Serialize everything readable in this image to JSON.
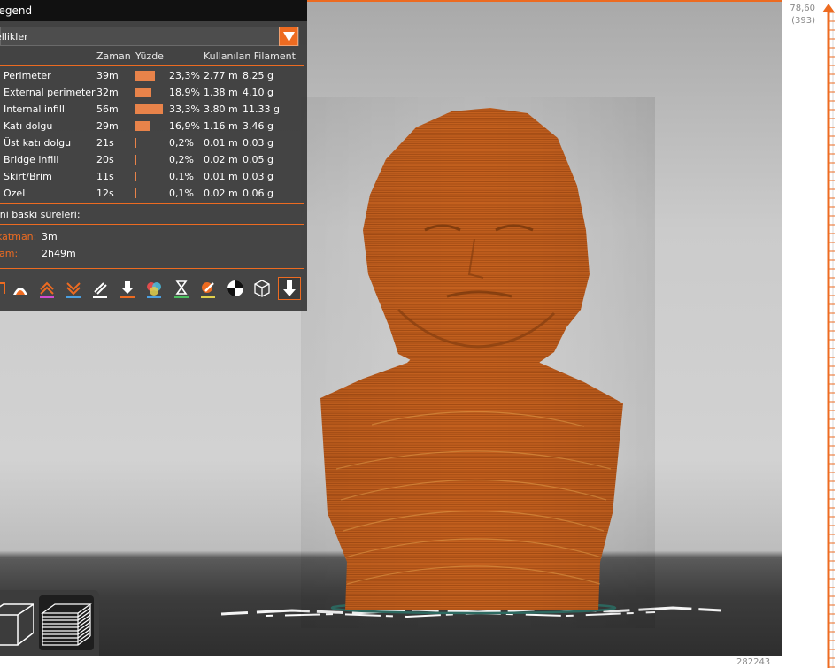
{
  "legend": {
    "title": "Legend",
    "view_type": "ellikler",
    "columns": {
      "time": "Zaman",
      "percent": "Yüzde",
      "used_filament": "Kullanılan Filament"
    },
    "rows": [
      {
        "name": "Perimeter",
        "time": "39m",
        "percent": "23,3%",
        "percent_value": 23.3,
        "length": "2.77 m",
        "weight": "8.25 g"
      },
      {
        "name": "External perimeter",
        "time": "32m",
        "percent": "18,9%",
        "percent_value": 18.9,
        "length": "1.38 m",
        "weight": "4.10 g"
      },
      {
        "name": "Internal infill",
        "time": "56m",
        "percent": "33,3%",
        "percent_value": 33.3,
        "length": "3.80 m",
        "weight": "11.33 g"
      },
      {
        "name": "Katı dolgu",
        "time": "29m",
        "percent": "16,9%",
        "percent_value": 16.9,
        "length": "1.16 m",
        "weight": "3.46 g"
      },
      {
        "name": "Üst katı dolgu",
        "time": "21s",
        "percent": "0,2%",
        "percent_value": 0.2,
        "length": "0.01 m",
        "weight": "0.03 g"
      },
      {
        "name": "Bridge infill",
        "time": "20s",
        "percent": "0,2%",
        "percent_value": 0.2,
        "length": "0.02 m",
        "weight": "0.05 g"
      },
      {
        "name": "Skirt/Brim",
        "time": "11s",
        "percent": "0,1%",
        "percent_value": 0.1,
        "length": "0.01 m",
        "weight": "0.03 g"
      },
      {
        "name": "Özel",
        "time": "12s",
        "percent": "0,1%",
        "percent_value": 0.1,
        "length": "0.02 m",
        "weight": "0.06 g"
      }
    ],
    "estimate_title": "mini baskı süreleri:",
    "estimates": [
      {
        "label": "katman:",
        "value": "3m"
      },
      {
        "label": "lam:",
        "value": "2h49m"
      }
    ],
    "toolbar_icons": [
      "travel-icon",
      "wipe-icon",
      "retractions-icon",
      "deretractions-icon",
      "seams-icon",
      "tool-changes-icon",
      "color-changes-icon",
      "pause-prints-icon",
      "custom-gcodes-icon",
      "center-of-gravity-icon",
      "shells-icon",
      "tool-marker-icon"
    ]
  },
  "accent_color": "#ed6b21",
  "model_color": "#c8621f",
  "slider": {
    "top_height": "78,60",
    "top_layer": "(393)"
  },
  "bottom_counter": "282243",
  "view_buttons": [
    "3d-view-icon",
    "layers-view-icon"
  ]
}
